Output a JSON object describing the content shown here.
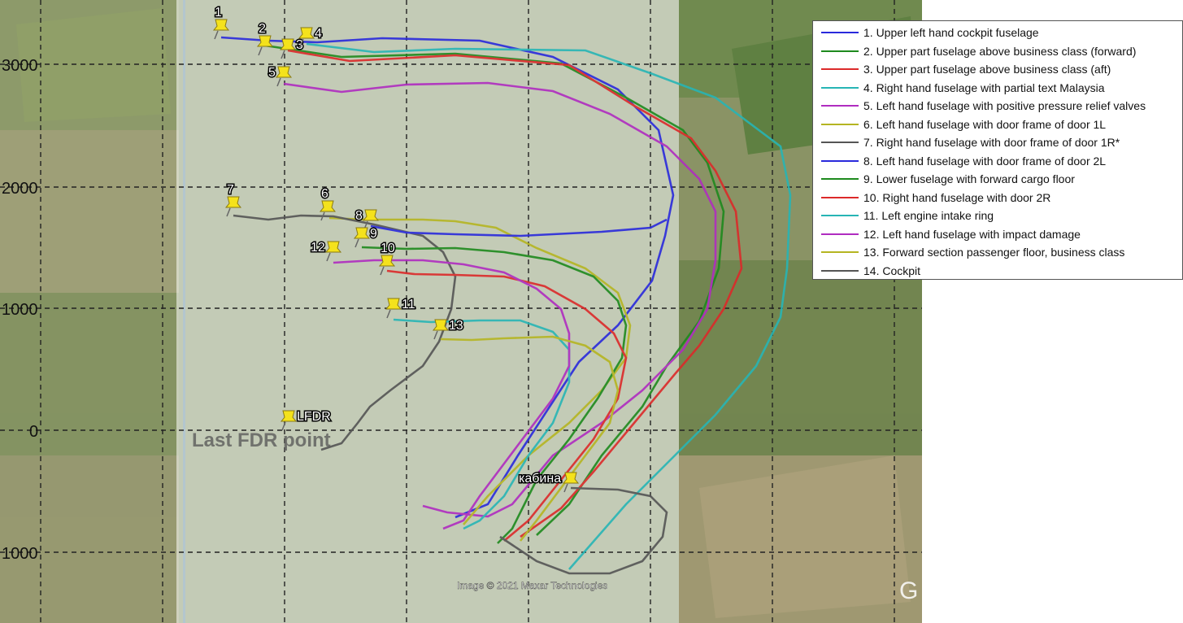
{
  "axis": {
    "y_ticks": [
      "3000",
      "2000",
      "1000",
      "0",
      "1000"
    ]
  },
  "annotations": {
    "last_fdr": "Last FDR point",
    "attribution": "Image © 2021 Maxar Technologies",
    "google_mark": "G"
  },
  "pins": [
    {
      "label": "1"
    },
    {
      "label": "2"
    },
    {
      "label": "3"
    },
    {
      "label": "4"
    },
    {
      "label": "5"
    },
    {
      "label": "6"
    },
    {
      "label": "7"
    },
    {
      "label": "8"
    },
    {
      "label": "9"
    },
    {
      "label": "10"
    },
    {
      "label": "11"
    },
    {
      "label": "12"
    },
    {
      "label": "13"
    },
    {
      "label": "LFDR"
    },
    {
      "label": "кабина"
    }
  ],
  "legend": [
    {
      "label": "1. Upper left hand cockpit fuselage",
      "color": "#2a2adc"
    },
    {
      "label": "2. Upper part fuselage above business class (forward)",
      "color": "#1e8a1e"
    },
    {
      "label": "3. Upper part fuselage above business class (aft)",
      "color": "#dc2a2a"
    },
    {
      "label": "4. Right hand fuselage with partial text Malaysia",
      "color": "#27b5b5"
    },
    {
      "label": "5. Left hand fuselage with positive pressure relief valves",
      "color": "#b02cc0"
    },
    {
      "label": "6. Left hand fuselage with door frame of door 1L",
      "color": "#b5b522"
    },
    {
      "label": "7. Right hand fuselage with door frame of door 1R*",
      "color": "#555555"
    },
    {
      "label": "8. Left hand fuselage with door frame of door 2L",
      "color": "#2a2adc"
    },
    {
      "label": "9. Lower fuselage with forward cargo floor",
      "color": "#1e8a1e"
    },
    {
      "label": "10. Right hand fuselage with door 2R",
      "color": "#dc2a2a"
    },
    {
      "label": "11. Left engine intake ring",
      "color": "#27b5b5"
    },
    {
      "label": "12. Left hand fuselage with impact damage",
      "color": "#b02cc0"
    },
    {
      "label": "13. Forward section passenger floor, business class",
      "color": "#b5b522"
    },
    {
      "label": "14. Cockpit",
      "color": "#555555"
    }
  ]
}
